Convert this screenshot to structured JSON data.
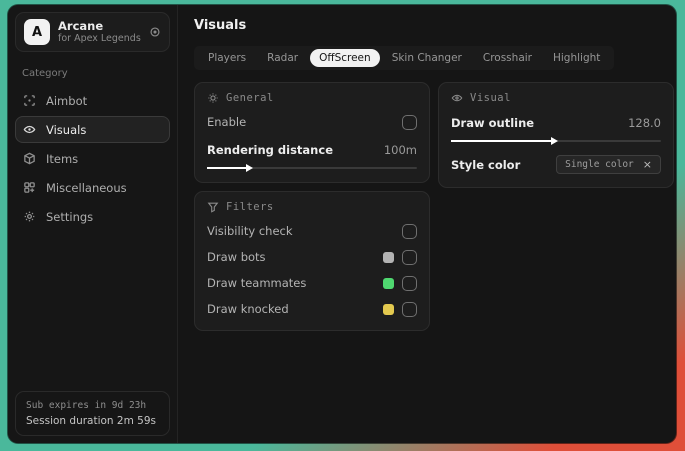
{
  "brand": {
    "initial": "A",
    "name": "Arcane",
    "subtitle": "for Apex Legends"
  },
  "sidebar": {
    "category_label": "Category",
    "items": [
      {
        "label": "Aimbot",
        "icon": "crosshair-icon"
      },
      {
        "label": "Visuals",
        "icon": "eye-scan-icon"
      },
      {
        "label": "Items",
        "icon": "box-icon"
      },
      {
        "label": "Miscellaneous",
        "icon": "grid-icon"
      },
      {
        "label": "Settings",
        "icon": "gear-icon"
      }
    ],
    "footer": {
      "expires": "Sub expires in 9d 23h",
      "session": "Session duration 2m 59s"
    }
  },
  "main": {
    "title": "Visuals",
    "tabs": [
      "Players",
      "Radar",
      "OffScreen",
      "Skin Changer",
      "Crosshair",
      "Highlight"
    ],
    "active_tab": "OffScreen"
  },
  "panels": {
    "general": {
      "title": "General",
      "enable_label": "Enable",
      "enable_checked": false,
      "rendering_label": "Rendering distance",
      "rendering_value": "100m",
      "rendering_percent": 21
    },
    "visual": {
      "title": "Visual",
      "outline_label": "Draw outline",
      "outline_value": "128.0",
      "outline_percent": 50,
      "style_label": "Style color",
      "style_value": "Single color",
      "style_clear": "×"
    },
    "filters": {
      "title": "Filters",
      "rows": [
        {
          "label": "Visibility check",
          "swatch": null,
          "checked": false
        },
        {
          "label": "Draw bots",
          "swatch": "#b3b3b3",
          "checked": false
        },
        {
          "label": "Draw teammates",
          "swatch": "#4fd870",
          "checked": false
        },
        {
          "label": "Draw knocked",
          "swatch": "#e3c94f",
          "checked": false
        }
      ]
    }
  },
  "colors": {
    "desktop_teal": "#4ab89b",
    "desktop_red": "#df4f39",
    "active_tab_bg": "#f2f2f2"
  }
}
